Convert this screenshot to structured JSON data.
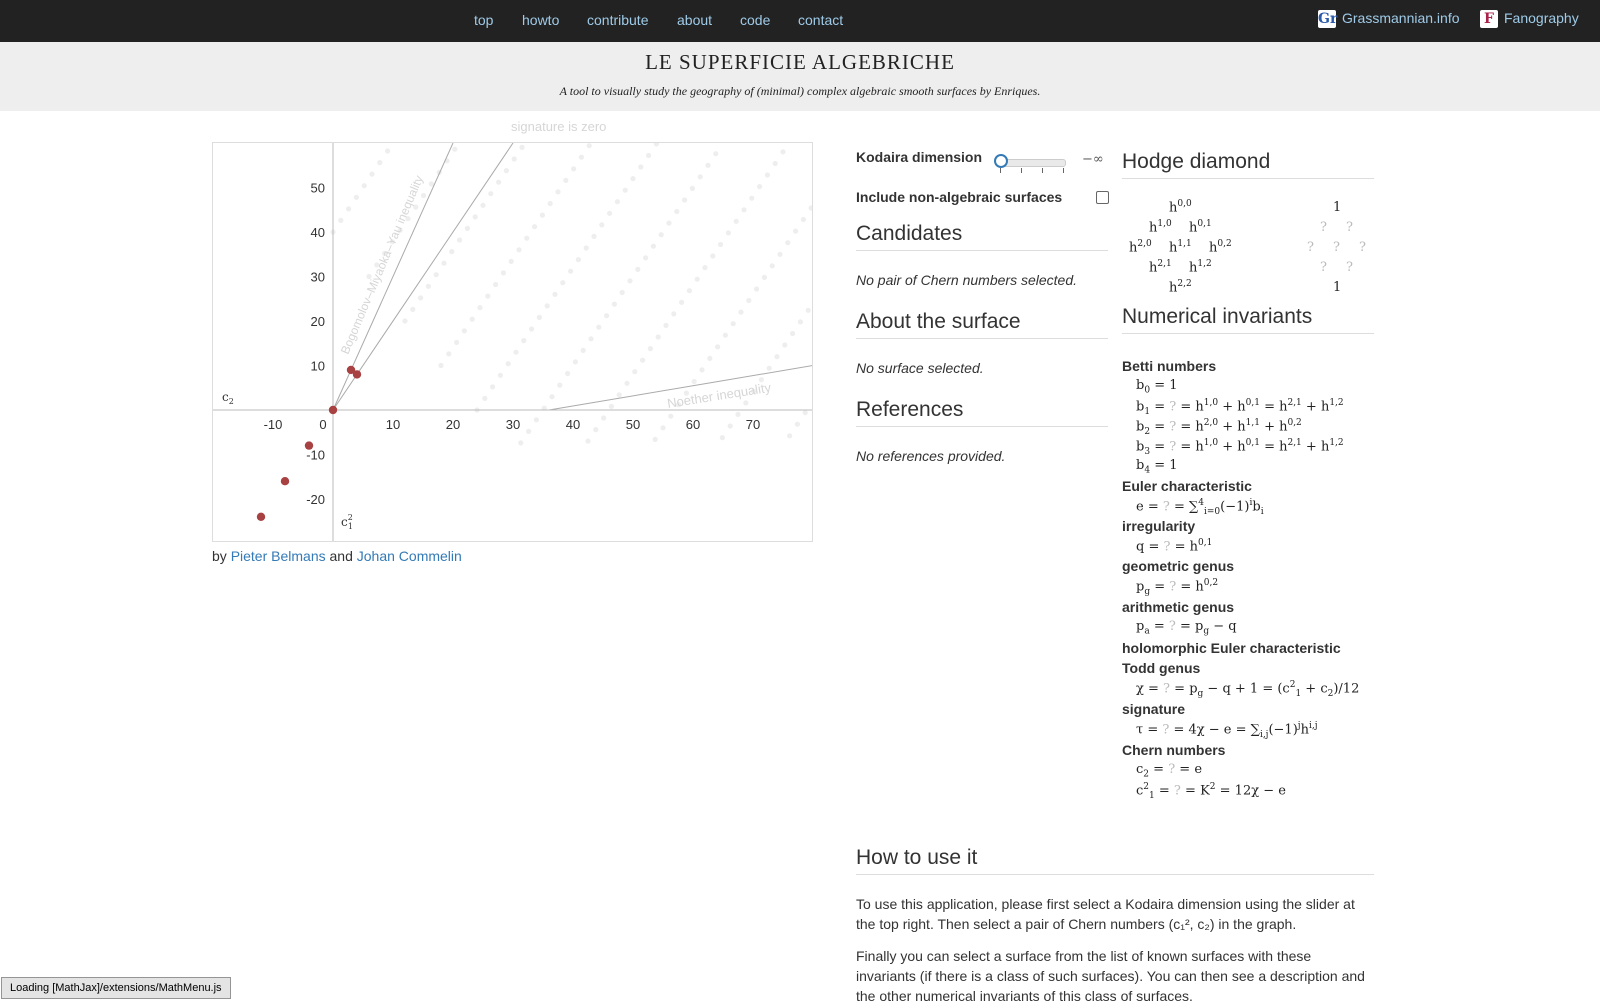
{
  "nav": {
    "links": [
      "top",
      "howto",
      "contribute",
      "about",
      "code",
      "contact"
    ],
    "grassmannian": {
      "logo": "Gr",
      "label": "Grassmannian.info"
    },
    "fanography": {
      "logo": "F",
      "label": "Fanography"
    }
  },
  "header": {
    "title": "LE SUPERFICIE ALGEBRICHE",
    "subtitle": "A tool to visually study the geography of (minimal) complex algebraic smooth surfaces by Enriques."
  },
  "graph": {
    "caption": "signature is zero",
    "bmy_label": "Bogomolov–Miyaoka–Yau inequality",
    "noether_label": "Noether inequality",
    "axis_c2": "c",
    "axis_c2_sub": "2",
    "axis_c1": "c",
    "axis_c1_sup": "2",
    "axis_c1_sub": "1",
    "x_ticks": [
      "-10",
      "0",
      "10",
      "20",
      "30",
      "40",
      "50",
      "60",
      "70"
    ],
    "y_ticks": [
      "50",
      "40",
      "30",
      "20",
      "10",
      "-10",
      "-20"
    ]
  },
  "chart_data": {
    "type": "scatter",
    "title": "",
    "xlabel": "c1^2",
    "ylabel": "c2",
    "xlim": [
      -20,
      80
    ],
    "ylim": [
      -30,
      60
    ],
    "highlighted_points": [
      [
        0,
        0
      ],
      [
        3,
        9
      ],
      [
        4,
        8
      ],
      [
        -4,
        -8
      ],
      [
        -8,
        -16
      ],
      [
        -12,
        -24
      ]
    ],
    "lines": [
      "Bogomolov–Miyaoka–Yau inequality",
      "Noether inequality",
      "signature is zero"
    ]
  },
  "credits": {
    "by": "by",
    "author1": "Pieter Belmans",
    "and": "and",
    "author2": "Johan Commelin"
  },
  "controls": {
    "kodaira_label": "Kodaira dimension",
    "kodaira_value": "−∞",
    "nonalgebraic_label": "Include non-algebraic surfaces"
  },
  "sections": {
    "candidates": {
      "title": "Candidates",
      "text": "No pair of Chern numbers selected."
    },
    "about": {
      "title": "About the surface",
      "text": "No surface selected."
    },
    "references": {
      "title": "References",
      "text": "No references provided."
    },
    "hodge": {
      "title": "Hodge diamond",
      "one": "1",
      "unknown": "?"
    },
    "numerical": {
      "title": "Numerical invariants"
    },
    "howto": {
      "title": "How to use it",
      "p1": "To use this application, please first select a Kodaira dimension using the slider at the top right. Then select a pair of Chern numbers (c₁², c₂) in the graph.",
      "p2": "Finally you can select a surface from the list of known surfaces with these invariants (if there is a class of such surfaces). You can then see a description and the other numerical invariants of this class of surfaces."
    }
  },
  "invariants": {
    "betti": "Betti numbers",
    "euler": "Euler characteristic",
    "irregularity": "irregularity",
    "geometric": "geometric genus",
    "arithmetic": "arithmetic genus",
    "holomorphic": "holomorphic Euler characteristic",
    "todd": "Todd genus",
    "signature": "signature",
    "chern": "Chern numbers"
  },
  "status": {
    "text": "Loading [MathJax]/extensions/MathMenu.js"
  }
}
